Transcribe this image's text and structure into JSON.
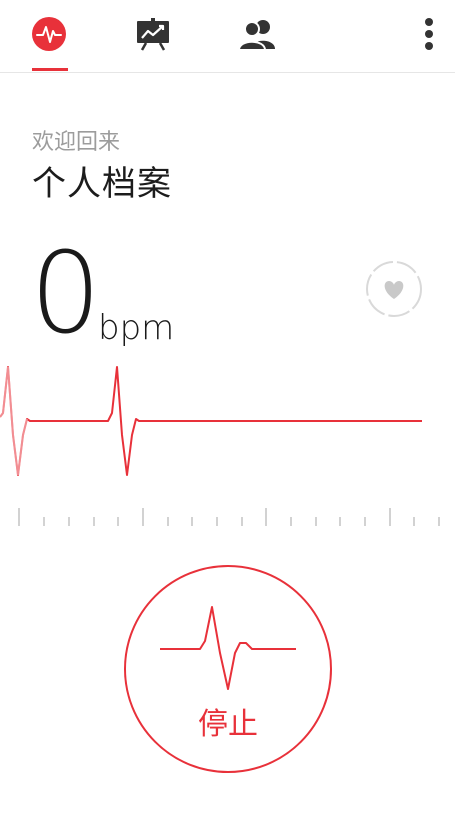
{
  "tabs": [
    {
      "id": "heart-rate",
      "icon": "heartbeat-icon",
      "active": true
    },
    {
      "id": "statistics",
      "icon": "chart-board-icon",
      "active": false
    },
    {
      "id": "friends",
      "icon": "people-icon",
      "active": false
    }
  ],
  "menu": {
    "icon": "overflow-menu-icon"
  },
  "greeting": {
    "welcome": "欢迎回来",
    "title": "个人档案"
  },
  "reading": {
    "value": "0",
    "unit": "bpm",
    "status_icon": "heart-icon"
  },
  "stop_button": {
    "label": "停止",
    "icon": "pulse-wave-icon"
  },
  "colors": {
    "accent": "#e8313a",
    "icon_dark": "#333333",
    "muted_text": "#9c9c9c",
    "ring": "#d9d9d9"
  }
}
